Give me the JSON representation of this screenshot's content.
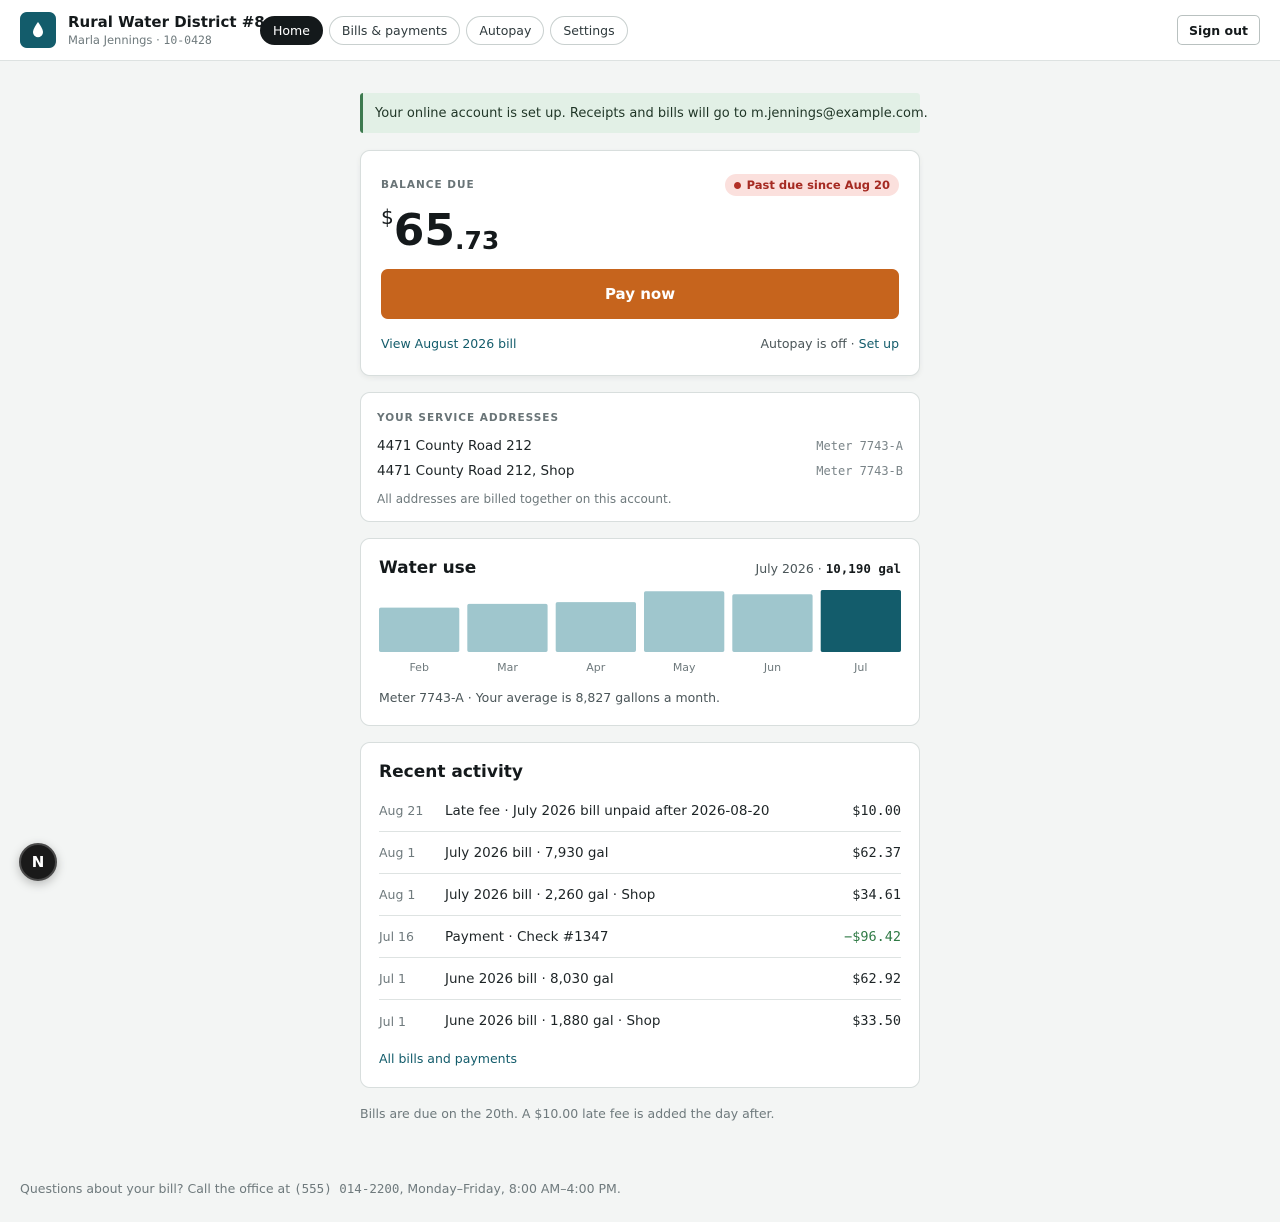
{
  "header": {
    "title": "Rural Water District #8",
    "account_holder": "Marla Jennings",
    "account_number": "10-0428",
    "nav": [
      {
        "label": "Home",
        "active": true
      },
      {
        "label": "Bills & payments",
        "active": false
      },
      {
        "label": "Autopay",
        "active": false
      },
      {
        "label": "Settings",
        "active": false
      }
    ],
    "sign_out": "Sign out",
    "logo_icon": "water-drop-icon"
  },
  "notice": "Your online account is set up. Receipts and bills will go to m.jennings@example.com.",
  "balance": {
    "label": "BALANCE DUE",
    "status": "Past due since Aug 20",
    "currency": "$",
    "dollars": "65",
    "cents": ".73",
    "pay_label": "Pay now",
    "view_bill": "View August 2026 bill",
    "autopay_text": "Autopay is off ·",
    "autopay_link": "Set up"
  },
  "addresses": {
    "label": "YOUR SERVICE ADDRESSES",
    "items": [
      {
        "address": "4471 County Road 212",
        "meter": "Meter 7743-A"
      },
      {
        "address": "4471 County Road 212, Shop",
        "meter": "Meter 7743-B"
      }
    ],
    "note": "All addresses are billed together on this account."
  },
  "water_use": {
    "title": "Water use",
    "period": "July 2026 ·",
    "total": "10,190 gal",
    "note": "Meter 7743-A · Your average is 8,827 gallons a month."
  },
  "chart_data": {
    "type": "bar",
    "categories": [
      "Feb",
      "Mar",
      "Apr",
      "May",
      "Jun",
      "Jul"
    ],
    "values": [
      7300,
      7900,
      8200,
      10000,
      9500,
      10190
    ],
    "highlight_index": 5,
    "colors": {
      "bar": "#9fc6cd",
      "highlight": "#135c6b"
    }
  },
  "activity": {
    "title": "Recent activity",
    "rows": [
      {
        "date": "Aug 21",
        "desc": "Late fee · July 2026 bill unpaid after 2026-08-20",
        "amount": "$10.00",
        "credit": false
      },
      {
        "date": "Aug 1",
        "desc": "July 2026 bill · 7,930 gal",
        "amount": "$62.37",
        "credit": false
      },
      {
        "date": "Aug 1",
        "desc": "July 2026 bill · 2,260 gal · Shop",
        "amount": "$34.61",
        "credit": false
      },
      {
        "date": "Jul 16",
        "desc": "Payment · Check #1347",
        "amount": "−$96.42",
        "credit": true
      },
      {
        "date": "Jul 1",
        "desc": "June 2026 bill · 8,030 gal",
        "amount": "$62.92",
        "credit": false
      },
      {
        "date": "Jul 1",
        "desc": "June 2026 bill · 1,880 gal · Shop",
        "amount": "$33.50",
        "credit": false
      }
    ],
    "all_link": "All bills and payments"
  },
  "due_note": "Bills are due on the 20th. A $10.00 late fee is added the day after.",
  "footer": {
    "before": "Questions about your bill? Call the office at",
    "phone": "(555) 014-2200",
    "after": ", Monday–Friday, 8:00 AM–4:00 PM."
  },
  "floating_button": "N"
}
